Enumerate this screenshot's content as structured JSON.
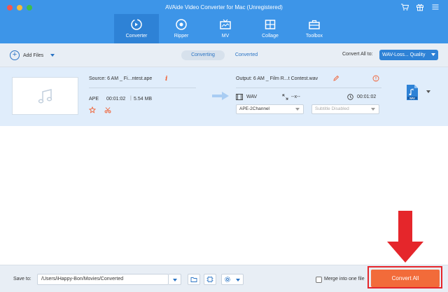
{
  "window": {
    "title": "AVAide Video Converter for Mac (Unregistered)"
  },
  "top_icons": [
    "cart-icon",
    "gift-icon",
    "menu-icon"
  ],
  "nav": {
    "tabs": [
      {
        "label": "Converter",
        "icon": "converter-icon",
        "active": true
      },
      {
        "label": "Ripper",
        "icon": "disc-icon",
        "active": false
      },
      {
        "label": "MV",
        "icon": "tv-icon",
        "active": false
      },
      {
        "label": "Collage",
        "icon": "collage-icon",
        "active": false
      },
      {
        "label": "Toolbox",
        "icon": "toolbox-icon",
        "active": false
      }
    ]
  },
  "toolbar": {
    "add_files_label": "Add Files",
    "segments": [
      "Converting",
      "Converted"
    ],
    "active_segment": "Converting",
    "convert_all_to_label": "Convert All to:",
    "format_value": "WAV-Loss... Quality"
  },
  "file": {
    "source_name": "Source: 6 AM _ Fi...ntest.ape",
    "source_format": "APE",
    "source_duration": "00:01:02",
    "source_size": "5.54 MB",
    "output_name": "Output: 6 AM _ Film R...t Contest.wav",
    "output_format": "WAV",
    "output_resolution": "--x--",
    "output_duration": "00:01:02",
    "audio_track": "APE-2Channel",
    "subtitle": "Subtitle Disabled",
    "badge_format": "WAV"
  },
  "bottom": {
    "save_to_label": "Save to:",
    "path": "/Users/iHappy-Bon/Movies/Converted",
    "merge_label": "Merge into one file",
    "merge_checked": false,
    "convert_all_label": "Convert All"
  },
  "colors": {
    "header_blue": "#3d95e8",
    "active_tab": "#2e82d6",
    "accent_orange": "#f26b3a",
    "annotation_red": "#e5262b"
  }
}
